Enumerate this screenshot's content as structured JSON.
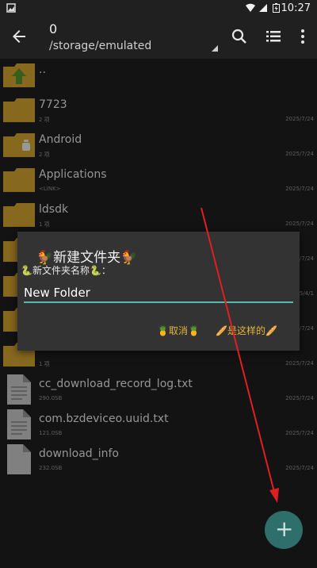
{
  "status": {
    "time": "10:27"
  },
  "appbar": {
    "title": "0",
    "path": "/storage/emulated"
  },
  "files": [
    {
      "name": "..",
      "meta": "",
      "date": "",
      "type": "parent"
    },
    {
      "name": "7723",
      "meta": "2 项",
      "date": "2025/7/24",
      "type": "folder"
    },
    {
      "name": "Android",
      "meta": "2 项",
      "date": "2025/7/24",
      "type": "folder"
    },
    {
      "name": "Applications",
      "meta": "<LINK>",
      "date": "2025/7/24",
      "type": "folder"
    },
    {
      "name": "ldsdk",
      "meta": "1 项",
      "date": "2025/7/24",
      "type": "folder"
    },
    {
      "name": "",
      "meta": "",
      "date": "2025/7/24",
      "type": "folder"
    },
    {
      "name": "",
      "meta": "",
      "date": "2025/4/1",
      "type": "folder"
    },
    {
      "name": "",
      "meta": "",
      "date": "2025/7/24",
      "type": "folder"
    },
    {
      "name": "",
      "meta": "1 项",
      "date": "2025/7/24",
      "type": "folder"
    },
    {
      "name": "cc_download_record_log.txt",
      "meta": "290.0SB",
      "date": "2025/7/24",
      "type": "file"
    },
    {
      "name": "com.bzdeviceo.uuid.txt",
      "meta": "121.0SB",
      "date": "2025/7/24",
      "type": "file"
    },
    {
      "name": "download_info",
      "meta": "232.0SB",
      "date": "2025/7/24",
      "type": "file"
    }
  ],
  "dialog": {
    "title": "🐓新建文件夹🐓",
    "label": "🐍新文件夹名称🐍：",
    "input_value": "New Folder",
    "cancel": "🍍取消🍍",
    "confirm": "🥖是这样的🥖"
  },
  "colors": {
    "accent": "#59b8b0",
    "button_text": "#e6b43a",
    "folder": "#c79a2e",
    "fab": "#2f6f6b",
    "annotation": "#e02020"
  }
}
